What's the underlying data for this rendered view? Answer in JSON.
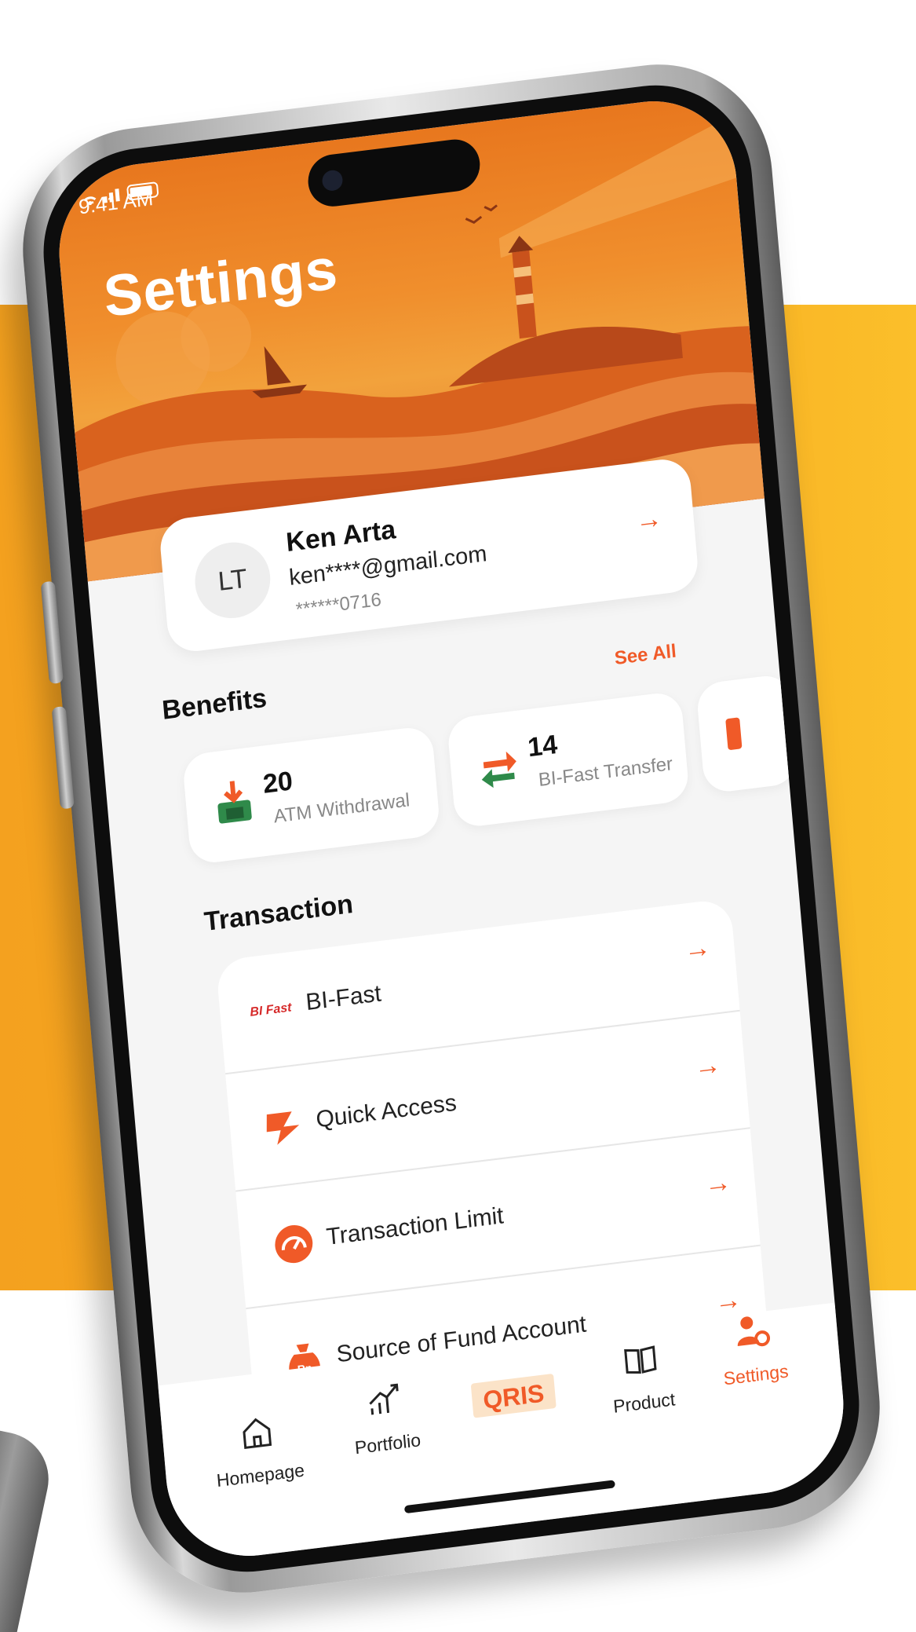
{
  "status_bar": {
    "time": "9:41 AM"
  },
  "header": {
    "title": "Settings"
  },
  "profile": {
    "initials": "LT",
    "name": "Ken Arta",
    "email": "ken****@gmail.com",
    "account": "******0716"
  },
  "benefits": {
    "title": "Benefits",
    "see_all": "See All",
    "items": [
      {
        "count": "20",
        "label": "ATM Withdrawal",
        "icon": "atm-withdrawal-icon"
      },
      {
        "count": "14",
        "label": "BI-Fast Transfer",
        "icon": "transfer-icon"
      }
    ]
  },
  "transaction": {
    "title": "Transaction",
    "items": [
      {
        "label": "BI-Fast",
        "icon": "bi-fast-logo",
        "logo_text": "BI Fast"
      },
      {
        "label": "Quick Access",
        "icon": "quick-access-icon"
      },
      {
        "label": "Transaction Limit",
        "icon": "speedometer-icon"
      },
      {
        "label": "Source of Fund Account",
        "icon": "money-bag-icon",
        "icon_text": "Rp"
      }
    ]
  },
  "nav": {
    "items": [
      {
        "label": "Homepage",
        "icon": "home-icon"
      },
      {
        "label": "Portfolio",
        "icon": "chart-icon"
      },
      {
        "label": "",
        "icon": "qris-logo",
        "logo_text": "QRIS"
      },
      {
        "label": "Product",
        "icon": "book-icon"
      },
      {
        "label": "Settings",
        "icon": "user-gear-icon",
        "active": true
      }
    ]
  },
  "colors": {
    "accent": "#f05a28",
    "band": "#f7ab22",
    "hero": "#ee8a2a"
  }
}
